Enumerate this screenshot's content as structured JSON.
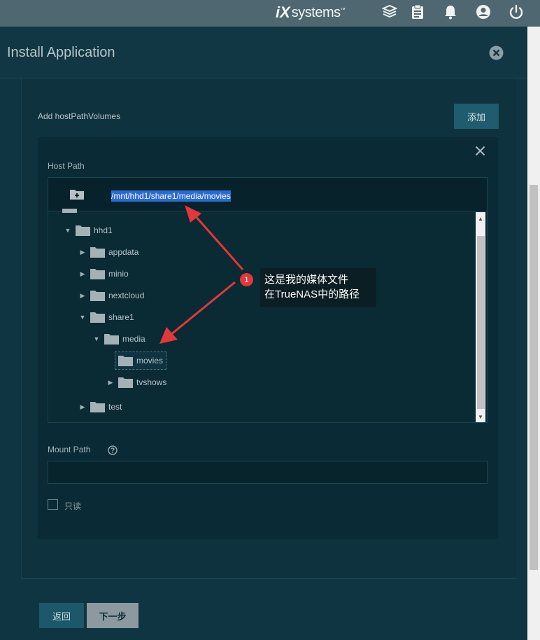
{
  "topbar": {
    "brand_ix": "iX",
    "brand_systems": "systems",
    "brand_tm": "™",
    "icons": [
      "truecommand-icon",
      "tasks-clipboard-icon",
      "notifications-bell-icon",
      "account-icon",
      "power-icon"
    ]
  },
  "dialog": {
    "title": "Install Application",
    "add_host_path_label": "Add hostPathVolumes",
    "add_button": "添加",
    "host_path_label": "Host Path",
    "current_path": "/mnt/hhd1/share1/media/movies",
    "tree": [
      {
        "label": "hhd1",
        "expanded": true
      },
      {
        "label": "appdata",
        "expanded": false
      },
      {
        "label": "minio",
        "expanded": false
      },
      {
        "label": "nextcloud",
        "expanded": false
      },
      {
        "label": "share1",
        "expanded": true
      },
      {
        "label": "media",
        "expanded": true
      },
      {
        "label": "movies",
        "selected": true
      },
      {
        "label": "tvshows",
        "expanded": false
      },
      {
        "label": "test",
        "expanded": false
      }
    ],
    "mount_path_label": "Mount Path",
    "mount_path_value": "",
    "readonly_label": "只读",
    "readonly_checked": false,
    "back_button": "返回",
    "next_button": "下一步"
  },
  "annotation": {
    "badge": "1",
    "line1": "这是我的媒体文件",
    "line2": "在TrueNAS中的路径",
    "color": "#e2383b"
  }
}
